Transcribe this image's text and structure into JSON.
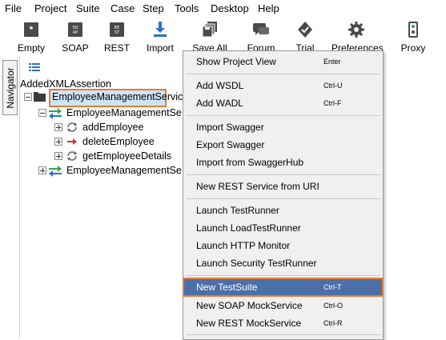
{
  "menubar": {
    "items": [
      {
        "label": "File"
      },
      {
        "label": "Project"
      },
      {
        "label": "Suite"
      },
      {
        "label": "Case"
      },
      {
        "label": "Step"
      },
      {
        "label": "Tools"
      },
      {
        "label": "Desktop"
      },
      {
        "label": "Help"
      }
    ]
  },
  "toolbar": {
    "buttons": [
      {
        "label": "Empty",
        "icon": "empty-project-icon"
      },
      {
        "label": "SOAP",
        "icon": "soap-icon"
      },
      {
        "label": "REST",
        "icon": "rest-icon"
      },
      {
        "label": "Import",
        "icon": "import-icon"
      },
      {
        "label": "Save All",
        "icon": "save-all-icon"
      },
      {
        "label": "Forum",
        "icon": "forum-icon"
      },
      {
        "label": "Trial",
        "icon": "trial-icon"
      },
      {
        "label": "Preferences",
        "icon": "gear-icon"
      },
      {
        "label": "Proxy",
        "icon": "proxy-icon"
      }
    ]
  },
  "navigator": {
    "tab_label": "Navigator"
  },
  "tree": {
    "root_label": "AddedXMLAssertion",
    "project": "EmployeeManagementServic",
    "service_1": "EmployeeManagementSe",
    "operations": [
      {
        "label": "addEmployee",
        "icon": "refresh-operation-icon"
      },
      {
        "label": "deleteEmployee",
        "icon": "arrow-operation-icon"
      },
      {
        "label": "getEmployeeDetails",
        "icon": "refresh-operation-icon"
      }
    ],
    "service_2": "EmployeeManagementSe"
  },
  "context_menu": {
    "items": [
      {
        "label": "Show Project View",
        "shortcut": "Enter"
      },
      {
        "label": "Add WSDL",
        "shortcut": "Ctrl-U"
      },
      {
        "label": "Add WADL",
        "shortcut": "Ctrl-F"
      },
      {
        "label": "Import Swagger",
        "shortcut": ""
      },
      {
        "label": "Export Swagger",
        "shortcut": ""
      },
      {
        "label": "Import from SwaggerHub",
        "shortcut": ""
      },
      {
        "label": "New REST Service from URI",
        "shortcut": ""
      },
      {
        "label": "Launch TestRunner",
        "shortcut": ""
      },
      {
        "label": "Launch LoadTestRunner",
        "shortcut": ""
      },
      {
        "label": "Launch HTTP Monitor",
        "shortcut": ""
      },
      {
        "label": "Launch Security TestRunner",
        "shortcut": ""
      },
      {
        "label": "New TestSuite",
        "shortcut": "Ctrl-T"
      },
      {
        "label": "New SOAP MockService",
        "shortcut": "Ctrl-O"
      },
      {
        "label": "New REST MockService",
        "shortcut": "Ctrl-R"
      }
    ]
  },
  "colors": {
    "highlight_bg": "#4d6fa8",
    "callout_border": "#e87c32",
    "selection_bg": "#cfe3f7",
    "service_icon_green": "#2fa84f",
    "service_icon_blue": "#2b73c9",
    "operation_arrow": "#c0392b",
    "folder": "#3a3a3a"
  }
}
